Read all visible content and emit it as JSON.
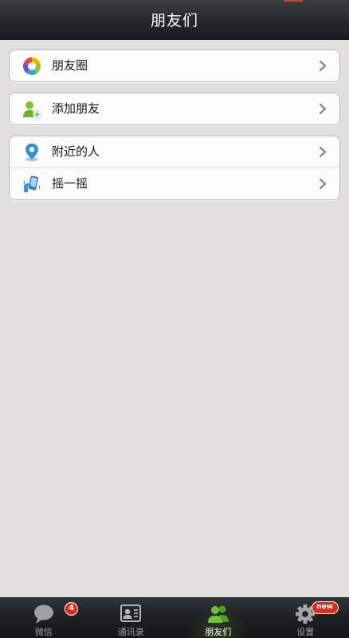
{
  "header": {
    "title": "朋友们"
  },
  "groups": [
    {
      "items": [
        {
          "label": "朋友圈",
          "icon": "moments-icon"
        }
      ]
    },
    {
      "items": [
        {
          "label": "添加朋友",
          "icon": "add-friend-icon"
        }
      ]
    },
    {
      "items": [
        {
          "label": "附近的人",
          "icon": "location-pin-icon"
        },
        {
          "label": "摇一摇",
          "icon": "shake-icon"
        }
      ]
    }
  ],
  "tabbar": {
    "tabs": [
      {
        "label": "微信",
        "icon": "chat-bubble-icon",
        "badge": "4"
      },
      {
        "label": "通讯录",
        "icon": "contacts-card-icon"
      },
      {
        "label": "朋友们",
        "icon": "friends-icon",
        "active": true
      },
      {
        "label": "设置",
        "icon": "gear-icon",
        "badge": "new"
      }
    ]
  },
  "colors": {
    "active_tab": "#5fb528",
    "badge": "#e02a1b",
    "header": "#25282a",
    "background": "#e1e0de"
  }
}
